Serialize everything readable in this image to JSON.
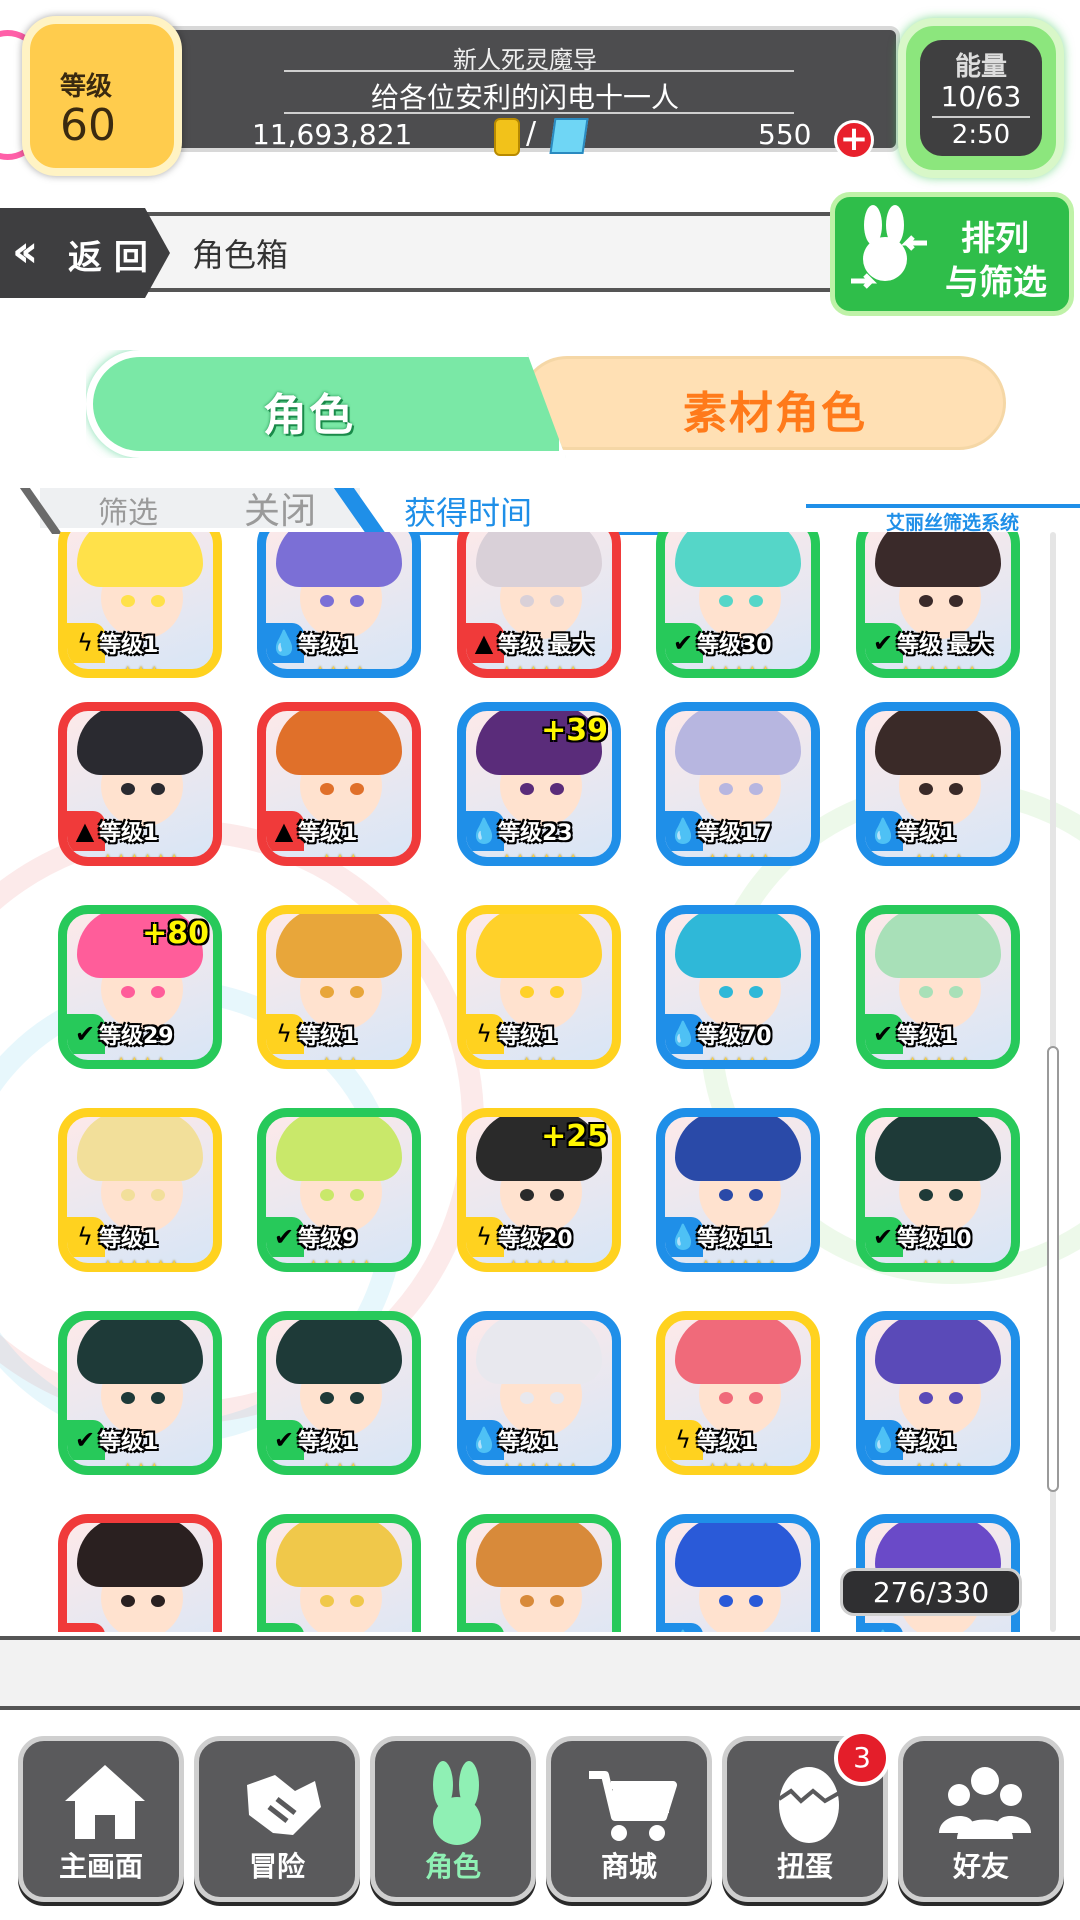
{
  "header": {
    "level_label": "等级",
    "level_value": "60",
    "rank_title": "新人死灵魔导",
    "player_name": "给各位安利的闪电十一人",
    "gold": "11,693,821",
    "separator": "/",
    "gems": "550",
    "energy_label": "能量",
    "energy_value": "10/63",
    "energy_timer": "2:50"
  },
  "nav": {
    "return_label": "返 回",
    "page_title": "角色箱",
    "sort_label_line1": "排列",
    "sort_label_line2": "与筛选"
  },
  "tabs": [
    {
      "label": "角色",
      "active": true
    },
    {
      "label": "素材角色",
      "active": false
    }
  ],
  "filter": {
    "filter_label": "筛选",
    "state_label": "关闭",
    "sort_by": "获得时间",
    "system_label": "艾丽丝筛选系统"
  },
  "colors": {
    "red": "#f03a3a",
    "blue": "#1f8fe8",
    "yellow": "#ffd21f",
    "green": "#27c95a"
  },
  "characters": [
    {
      "frame": "yellow",
      "element": "lightning",
      "level": "等级1",
      "stars": 3,
      "hair": "#ffe14a",
      "plus": ""
    },
    {
      "frame": "blue",
      "element": "water",
      "level": "等级1",
      "stars": 4,
      "hair": "#7b6fd6",
      "plus": ""
    },
    {
      "frame": "red",
      "element": "fire",
      "level": "等级 最大",
      "stars": 6,
      "hair": "#d9d0d8",
      "plus": ""
    },
    {
      "frame": "green",
      "element": "wind",
      "level": "等级30",
      "stars": 5,
      "hair": "#55d6c8",
      "plus": ""
    },
    {
      "frame": "green",
      "element": "wind",
      "level": "等级 最大",
      "stars": 6,
      "hair": "#3a2a2a",
      "plus": ""
    },
    {
      "frame": "red",
      "element": "fire",
      "level": "等级1",
      "stars": 6,
      "hair": "#2a2a30",
      "plus": ""
    },
    {
      "frame": "red",
      "element": "fire",
      "level": "等级1",
      "stars": 3,
      "hair": "#e0702a",
      "plus": ""
    },
    {
      "frame": "blue",
      "element": "water",
      "level": "等级23",
      "stars": 6,
      "hair": "#5a2c7a",
      "plus": "+39"
    },
    {
      "frame": "blue",
      "element": "water",
      "level": "等级17",
      "stars": 5,
      "hair": "#b7b6e0",
      "plus": ""
    },
    {
      "frame": "blue",
      "element": "water",
      "level": "等级1",
      "stars": 4,
      "hair": "#3a2a28",
      "plus": ""
    },
    {
      "frame": "green",
      "element": "wind",
      "level": "等级29",
      "stars": 4,
      "hair": "#ff5d9a",
      "plus": "+80"
    },
    {
      "frame": "yellow",
      "element": "lightning",
      "level": "等级1",
      "stars": 3,
      "hair": "#e8a63a",
      "plus": ""
    },
    {
      "frame": "yellow",
      "element": "lightning",
      "level": "等级1",
      "stars": 3,
      "hair": "#ffd12a",
      "plus": ""
    },
    {
      "frame": "blue",
      "element": "water",
      "level": "等级70",
      "stars": 5,
      "hair": "#2fb8d8",
      "plus": ""
    },
    {
      "frame": "green",
      "element": "wind",
      "level": "等级1",
      "stars": 5,
      "hair": "#a8e0b8",
      "plus": ""
    },
    {
      "frame": "yellow",
      "element": "lightning",
      "level": "等级1",
      "stars": 6,
      "hair": "#f2df9a",
      "plus": ""
    },
    {
      "frame": "green",
      "element": "wind",
      "level": "等级9",
      "stars": 5,
      "hair": "#c9e86a",
      "plus": ""
    },
    {
      "frame": "yellow",
      "element": "lightning",
      "level": "等级20",
      "stars": 5,
      "hair": "#2a2a2a",
      "plus": "+25"
    },
    {
      "frame": "blue",
      "element": "water",
      "level": "等级11",
      "stars": 6,
      "hair": "#2a4aa8",
      "plus": ""
    },
    {
      "frame": "green",
      "element": "wind",
      "level": "等级10",
      "stars": 3,
      "hair": "#1e3a38",
      "plus": ""
    },
    {
      "frame": "green",
      "element": "wind",
      "level": "等级1",
      "stars": 3,
      "hair": "#1e3a38",
      "plus": ""
    },
    {
      "frame": "green",
      "element": "wind",
      "level": "等级1",
      "stars": 3,
      "hair": "#1e3a38",
      "plus": ""
    },
    {
      "frame": "blue",
      "element": "water",
      "level": "等级1",
      "stars": 6,
      "hair": "#e8e8ee",
      "plus": ""
    },
    {
      "frame": "yellow",
      "element": "lightning",
      "level": "等级1",
      "stars": 5,
      "hair": "#f06a7a",
      "plus": ""
    },
    {
      "frame": "blue",
      "element": "water",
      "level": "等级1",
      "stars": 4,
      "hair": "#5a4ab8",
      "plus": ""
    },
    {
      "frame": "red",
      "element": "fire",
      "level": "",
      "stars": 0,
      "hair": "#2a2020",
      "plus": ""
    },
    {
      "frame": "green",
      "element": "wind",
      "level": "",
      "stars": 0,
      "hair": "#f0c84a",
      "plus": ""
    },
    {
      "frame": "green",
      "element": "wind",
      "level": "",
      "stars": 0,
      "hair": "#d88a3a",
      "plus": ""
    },
    {
      "frame": "blue",
      "element": "water",
      "level": "",
      "stars": 0,
      "hair": "#2a5ad8",
      "plus": ""
    },
    {
      "frame": "blue",
      "element": "water",
      "level": "",
      "stars": 0,
      "hair": "#6a4ac8",
      "plus": ""
    }
  ],
  "box_count": "276/330",
  "bottom_nav": [
    {
      "label": "主画面",
      "icon": "home-icon"
    },
    {
      "label": "冒险",
      "icon": "handshake-icon"
    },
    {
      "label": "角色",
      "icon": "rabbit-icon",
      "active": true
    },
    {
      "label": "商城",
      "icon": "cart-icon"
    },
    {
      "label": "扭蛋",
      "icon": "egg-icon",
      "badge": "3"
    },
    {
      "label": "好友",
      "icon": "friends-icon"
    }
  ]
}
